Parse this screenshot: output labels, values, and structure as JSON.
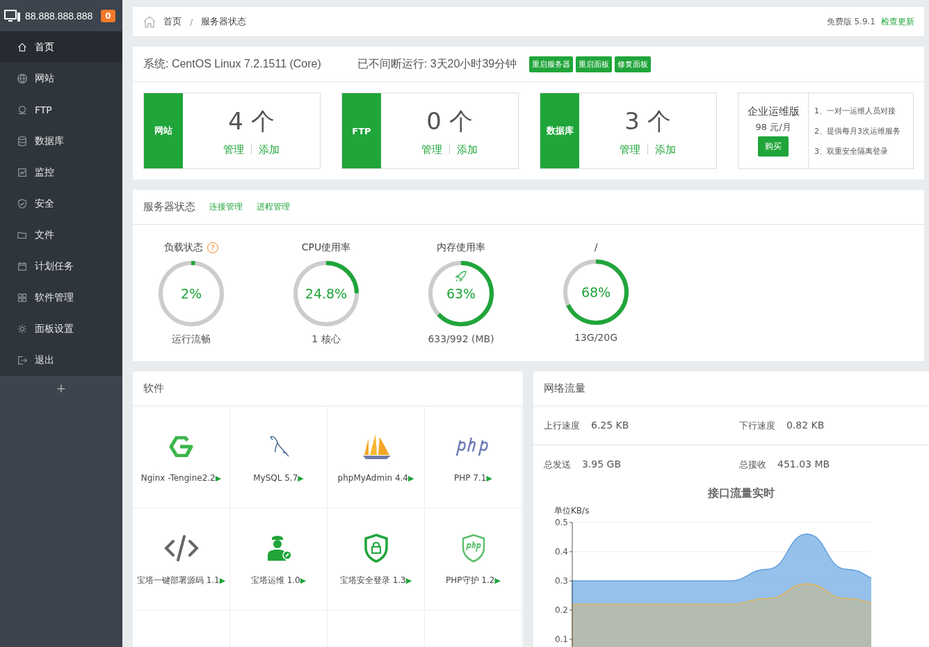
{
  "sidebar": {
    "host": "88.888.888.888",
    "badge": "0",
    "items": [
      {
        "label": "首页",
        "selected": true
      },
      {
        "label": "网站",
        "selected": false
      },
      {
        "label": "FTP",
        "selected": false
      },
      {
        "label": "数据库",
        "selected": false
      },
      {
        "label": "监控",
        "selected": false
      },
      {
        "label": "安全",
        "selected": false
      },
      {
        "label": "文件",
        "selected": false
      },
      {
        "label": "计划任务",
        "selected": false
      },
      {
        "label": "软件管理",
        "selected": false
      },
      {
        "label": "面板设置",
        "selected": false
      },
      {
        "label": "退出",
        "selected": false
      }
    ],
    "add": "+"
  },
  "breadcrumb": {
    "items": [
      "首页",
      "服务器状态"
    ],
    "separator": "/",
    "version": "免费版 5.9.1",
    "update_link": "检查更新"
  },
  "overview": {
    "system": "系统: CentOS Linux 7.2.1511 (Core)",
    "uptime": "已不间断运行: 3天20小时39分钟",
    "buttons": [
      "重启服务器",
      "重启面板",
      "修复面板"
    ],
    "stats": [
      {
        "label": "网站",
        "count": "4 个",
        "links": [
          "管理",
          "添加"
        ]
      },
      {
        "label": "FTP",
        "count": "0 个",
        "links": [
          "管理",
          "添加"
        ]
      },
      {
        "label": "数据库",
        "count": "3 个",
        "links": [
          "管理",
          "添加"
        ]
      }
    ],
    "promo": {
      "title": "企业运维版",
      "price": "98 元/月",
      "button": "购买",
      "features": [
        "1、一对一运维人员对接",
        "2、提供每月3次运维服务",
        "3、双重安全隔离登录"
      ]
    }
  },
  "server_status": {
    "title": "服务器状态",
    "links": [
      "连接管理",
      "进程管理"
    ],
    "gauges": [
      {
        "title": "负载状态",
        "help": "?",
        "value": "2%",
        "level": 0.02,
        "caption": "运行流畅"
      },
      {
        "title": "CPU使用率",
        "value": "24.8%",
        "level": 0.248,
        "caption": "1 核心"
      },
      {
        "title": "内存使用率",
        "value": "63%",
        "level": 0.63,
        "caption": "633/992 (MB)"
      },
      {
        "title": "/",
        "value": "68%",
        "level": 0.68,
        "caption": "13G/20G"
      }
    ]
  },
  "software": {
    "title": "软件",
    "items": [
      {
        "name": "Nginx -Tengine2.2",
        "arrow": "▶"
      },
      {
        "name": "MySQL 5.7",
        "arrow": "▶"
      },
      {
        "name": "phpMyAdmin 4.4",
        "arrow": "▶"
      },
      {
        "name": "PHP 7.1",
        "arrow": "▶"
      },
      {
        "name": "宝塔一键部署源码 1.1",
        "arrow": "▶"
      },
      {
        "name": "宝塔运维 1.0",
        "arrow": "▶"
      },
      {
        "name": "宝塔安全登录 1.3",
        "arrow": "▶"
      },
      {
        "name": "PHP守护 1.2",
        "arrow": "▶"
      }
    ]
  },
  "network": {
    "title": "网络流量",
    "stats": [
      {
        "label": "上行速度",
        "value": "6.25 KB"
      },
      {
        "label": "下行速度",
        "value": "0.82 KB"
      },
      {
        "label": "总发送",
        "value": "3.95 GB"
      },
      {
        "label": "总接收",
        "value": "451.03 MB"
      }
    ],
    "chart_data": {
      "type": "area",
      "title": "接口流量实时",
      "ylabel": "单位KB/s",
      "ylim": [
        0,
        0.5
      ],
      "yticks": [
        0.1,
        0.2,
        0.3,
        0.4,
        0.5
      ],
      "series": [
        {
          "color": "#5d9fe0",
          "values": [
            0.3,
            0.3,
            0.3,
            0.3,
            0.3,
            0.34,
            0.46,
            0.34,
            0.3
          ]
        },
        {
          "color": "#e0b35a",
          "values": [
            0.22,
            0.22,
            0.22,
            0.22,
            0.22,
            0.24,
            0.29,
            0.24,
            0.22
          ]
        }
      ]
    }
  }
}
